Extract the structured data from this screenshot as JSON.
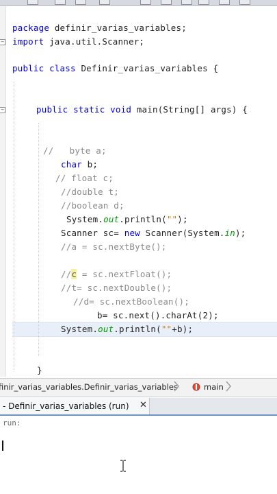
{
  "editor": {
    "lines": {
      "l1": {
        "kw": "package",
        "rest": " definir_varias_variables;"
      },
      "l2": {
        "kw": "import",
        "rest": " java.util.Scanner;"
      },
      "l3": {
        "kw": "public class",
        "rest": " Definir_varias_variables {"
      },
      "l4": {
        "kw": "public static void",
        "rest": " main(String[] args) {"
      },
      "l5": "//   byte a;",
      "l6": {
        "kw": "char",
        "rest": " b;"
      },
      "l7": "// float c;",
      "l8": "//double t;",
      "l9": "//boolean d;",
      "l10": {
        "a": "System.",
        "fld": "out",
        "b": ".println(",
        "str": "\"\"",
        "c": ");"
      },
      "l11": {
        "a": "Scanner sc= ",
        "kw": "new",
        "b": " Scanner(System.",
        "fld": "in",
        "c": ");"
      },
      "l12": "//a = sc.nextByte();",
      "l13": {
        "a": "//",
        "hl": "c",
        "b": " = sc.nextFloat();"
      },
      "l14": "//t= sc.nextDouble();",
      "l15": "//d= sc.nextBoolean();",
      "l16": "b= sc.next().charAt(2);",
      "l17": {
        "a": "System.",
        "fld": "out",
        "b": ".println(",
        "str": "\"\"",
        "c": "+b);"
      },
      "l18": "}"
    }
  },
  "breadcrumb": {
    "path": "finir_varias_variables.Definir_varias_variables",
    "method": "main"
  },
  "output_tab": {
    "label": "- Definir_varias_variables (run)",
    "close": "✕"
  },
  "console": {
    "text": "run:"
  },
  "colors": {
    "keyword": "#0000e6",
    "comment": "#8a8a8a",
    "field": "#009900",
    "string": "#ce7b00"
  },
  "icons": [
    "fold-toggle-icon",
    "chevron-right-icon",
    "method-icon",
    "close-icon",
    "text-cursor-icon"
  ]
}
